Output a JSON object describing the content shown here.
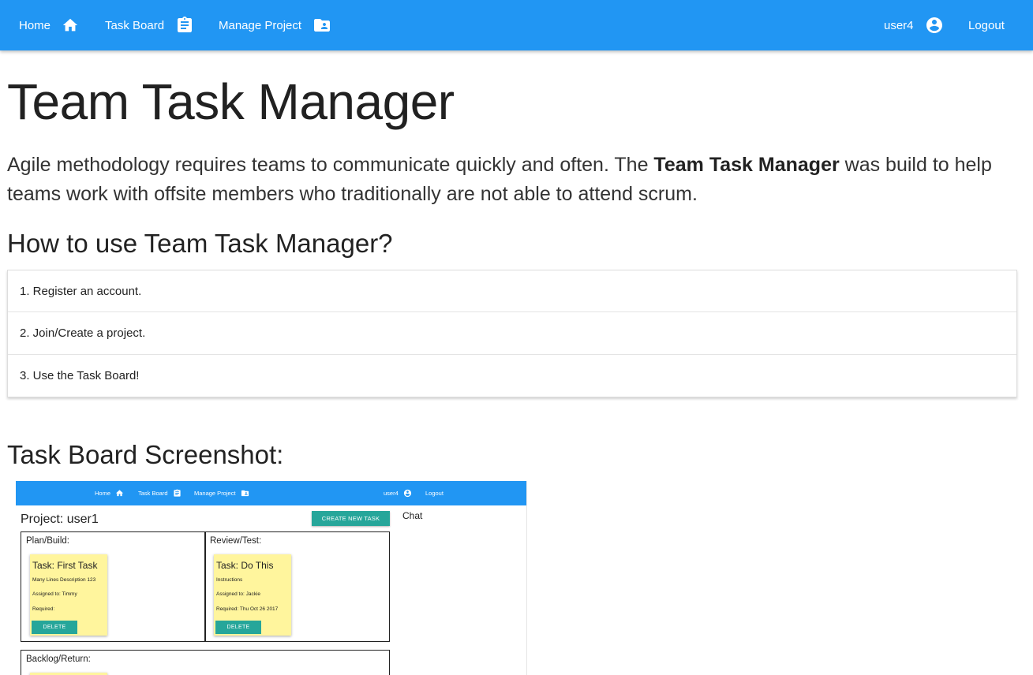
{
  "nav": {
    "home": "Home",
    "task_board": "Task Board",
    "manage_project": "Manage Project",
    "user": "user4",
    "logout": "Logout",
    "icons": [
      "home-icon",
      "clipboard-icon",
      "folder-account-icon",
      "account-circle-icon"
    ],
    "bar_color": "#2196f3"
  },
  "main": {
    "title": "Team Task Manager",
    "intro_before": "Agile methodology requires teams to communicate quickly and often. The ",
    "intro_bold": "Team Task Manager",
    "intro_after": " was build to help teams work with offsite members who traditionally are not able to attend scrum.",
    "how_heading": "How to use Team Task Manager?",
    "steps": [
      "1. Register an account.",
      "2. Join/Create a project.",
      "3. Use the Task Board!"
    ],
    "screenshot_heading": "Task Board Screenshot:"
  },
  "screenshot": {
    "nav": {
      "home": "Home",
      "task_board": "Task Board",
      "manage_project": "Manage Project",
      "user": "user4",
      "logout": "Logout"
    },
    "project_title": "Project: user1",
    "create_button": "CREATE NEW TASK",
    "chat_label": "Chat",
    "lanes": [
      {
        "title": "Plan/Build:",
        "card": {
          "title": "Task: First Task",
          "description": "Many Lines Description 123",
          "assigned": "Assigned to: Timmy",
          "required": "Required:",
          "delete": "DELETE"
        }
      },
      {
        "title": "Review/Test:",
        "card": {
          "title": "Task: Do This",
          "description": "Instructions",
          "assigned": "Assigned to: Jackie",
          "required": "Required: Thu Oct 26 2017",
          "delete": "DELETE"
        }
      },
      {
        "title": "Backlog/Return:"
      }
    ],
    "accent_color": "#26a69a",
    "card_color": "#fff59d"
  }
}
